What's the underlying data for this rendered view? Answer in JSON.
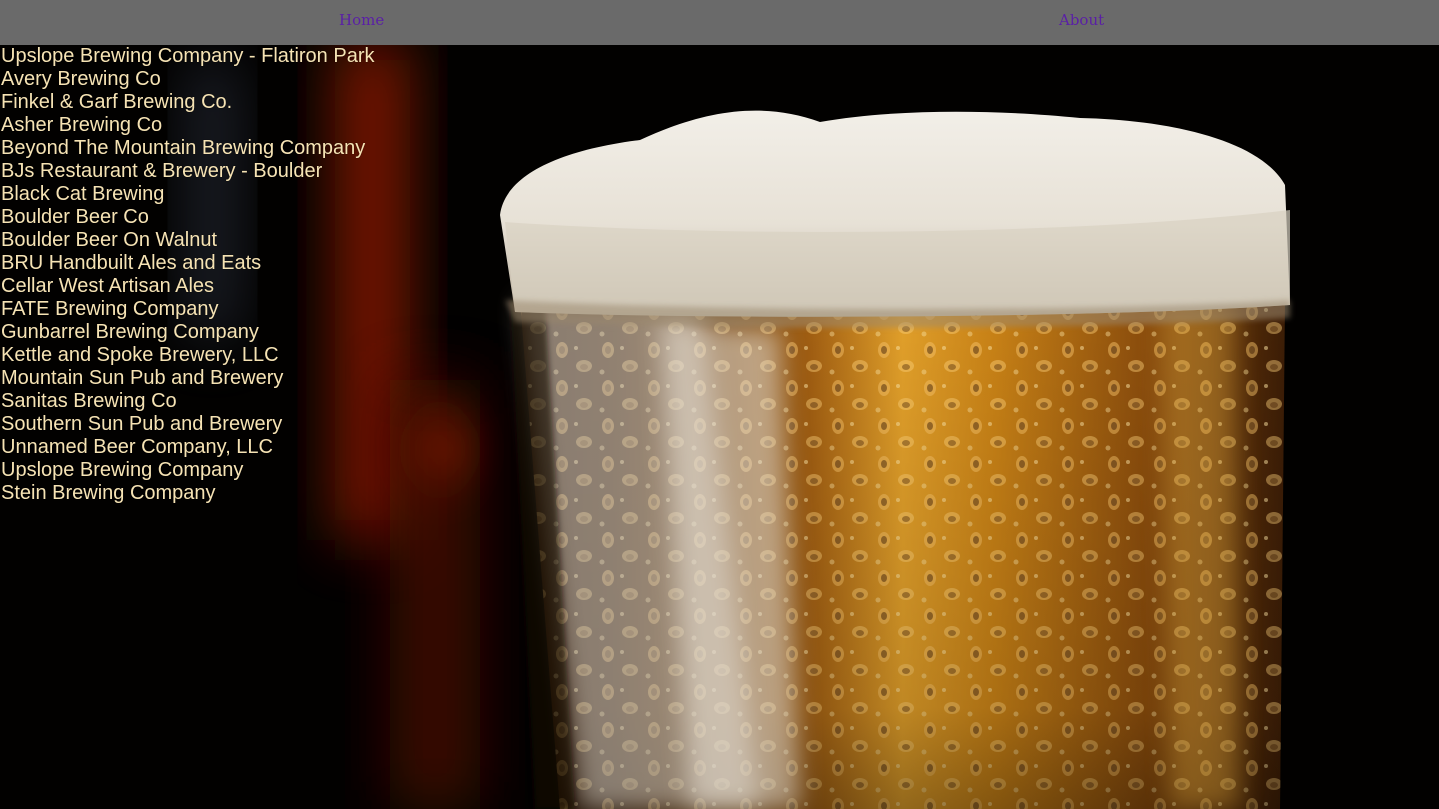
{
  "nav": {
    "home_label": "Home",
    "about_label": "About"
  },
  "breweries": [
    "Upslope Brewing Company - Flatiron Park",
    "Avery Brewing Co",
    "Finkel & Garf Brewing Co.",
    "Asher Brewing Co",
    "Beyond The Mountain Brewing Company",
    "BJs Restaurant & Brewery - Boulder",
    "Black Cat Brewing",
    "Boulder Beer Co",
    "Boulder Beer On Walnut",
    "BRU Handbuilt Ales and Eats",
    "Cellar West Artisan Ales",
    "FATE Brewing Company",
    "Gunbarrel Brewing Company",
    "Kettle and Spoke Brewery, LLC",
    "Mountain Sun Pub and Brewery",
    "Sanitas Brewing Co",
    "Southern Sun Pub and Brewery",
    "Unnamed Beer Company, LLC",
    "Upslope Brewing Company",
    "Stein Brewing Company"
  ],
  "colors": {
    "navbar_bg": "#6a6a6a",
    "nav_link": "#5a1fa6",
    "list_text": "#f6e3b4",
    "page_bg": "#000000"
  },
  "background_image": "beer-glass-photo"
}
